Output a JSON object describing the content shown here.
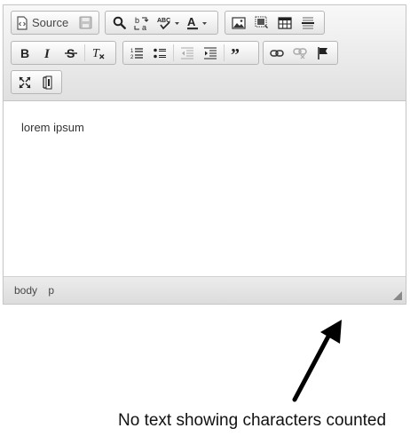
{
  "toolbar": {
    "source_label": "Source",
    "rows": [
      [
        [
          "source-button",
          "save-button"
        ],
        [
          "find-button",
          "replace-button",
          "spellcheck-button",
          "text-color-button"
        ],
        [
          "image-button",
          "flash-button",
          "table-button",
          "horizontal-line-button"
        ]
      ],
      [
        [
          "bold-button",
          "italic-button",
          "strikethrough-button",
          "remove-format-button"
        ],
        [
          "numbered-list-button",
          "bulleted-list-button",
          "decrease-indent-button",
          "increase-indent-button",
          "blockquote-button"
        ],
        [
          "link-button",
          "unlink-button",
          "anchor-button"
        ]
      ],
      [
        [
          "maximize-button",
          "show-blocks-button"
        ]
      ]
    ]
  },
  "content": {
    "text": "lorem ipsum"
  },
  "statusbar": {
    "path": [
      "body",
      "p"
    ]
  },
  "annotation": {
    "text": "No text showing characters counted"
  },
  "colors": {
    "toolbar_bg": "#e0e0e0",
    "border": "#c8c8c8",
    "arrow": "#000000"
  }
}
